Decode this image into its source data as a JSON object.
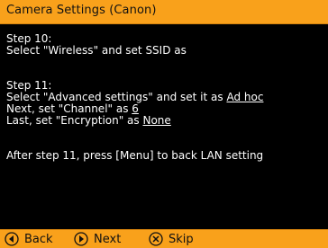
{
  "title": "Camera Settings (Canon)",
  "step10": {
    "heading": "Step 10:",
    "line1": "Select \"Wireless\" and set SSID as"
  },
  "step11": {
    "heading": "Step 11:",
    "line1_prefix": "Select \"Advanced settings\" and set it as ",
    "line1_value": "Ad hoc",
    "line2_prefix": "Next, set \"Channel\" as ",
    "line2_value": "6",
    "line3_prefix": "Last, set \"Encryption\" as ",
    "line3_value": "None"
  },
  "note": "After step 11, press [Menu] to back LAN setting",
  "footer": {
    "back_label": "Back",
    "next_label": "Next",
    "skip_label": "Skip"
  },
  "icons": {
    "back": "circle-left-arrow-icon",
    "next": "circle-right-arrow-icon",
    "skip": "circle-x-icon"
  },
  "colors": {
    "accent": "#f9a11b",
    "background": "#000000",
    "text": "#ffffff"
  }
}
